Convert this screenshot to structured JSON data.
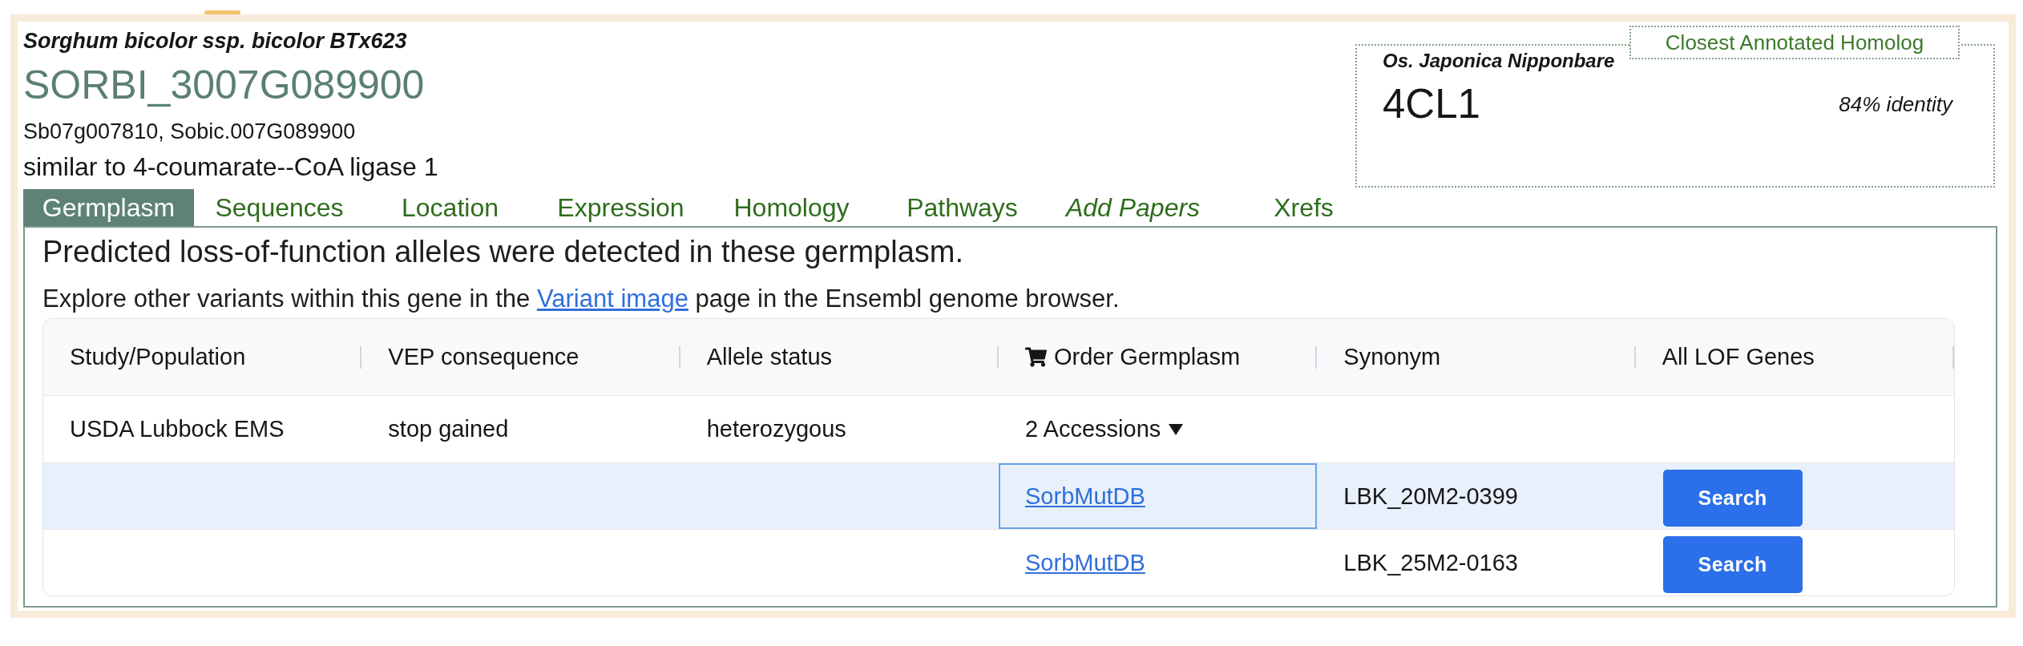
{
  "header": {
    "species": "Sorghum bicolor ssp. bicolor BTx623",
    "gene_id": "SORBI_3007G089900",
    "synonyms": "Sb07g007810, Sobic.007G089900",
    "description": "similar to 4-coumarate--CoA ligase 1"
  },
  "homolog": {
    "legend": "Closest Annotated Homolog",
    "species": "Os. Japonica Nipponbare",
    "gene": "4CL1",
    "identity": "84% identity"
  },
  "tabs": [
    {
      "label": "Germplasm",
      "kind": "section",
      "selected": true
    },
    {
      "label": "Sequences",
      "kind": "section",
      "selected": false
    },
    {
      "label": "Location",
      "kind": "section",
      "selected": false
    },
    {
      "label": "Expression",
      "kind": "section",
      "selected": false
    },
    {
      "label": "Homology",
      "kind": "section",
      "selected": false
    },
    {
      "label": "Pathways",
      "kind": "section",
      "selected": false
    },
    {
      "label": "Add Papers",
      "kind": "action",
      "selected": false
    },
    {
      "label": "Xrefs",
      "kind": "section",
      "selected": false
    }
  ],
  "panel": {
    "heading": "Predicted loss-of-function alleles were detected in these germplasm.",
    "note": {
      "before": "Explore other variants within this gene in the ",
      "link": "Variant image",
      "after": " page in the Ensembl genome browser."
    }
  },
  "table": {
    "columns": [
      {
        "label": "Study/Population",
        "kind": "text"
      },
      {
        "label": "VEP consequence",
        "kind": "text"
      },
      {
        "label": "Allele status",
        "kind": "text"
      },
      {
        "label": "Order Germplasm",
        "kind": "order"
      },
      {
        "label": "Synonym",
        "kind": "text"
      },
      {
        "label": "All LOF Genes",
        "kind": "text"
      }
    ],
    "rows": [
      {
        "cells": [
          "USDA Lubbock EMS",
          "stop gained",
          "heterozygous"
        ],
        "accessions": {
          "label": "2 Accessions",
          "expanded": true
        },
        "sub_rows": [
          {
            "source": "SorbMutDB",
            "synonym": "LBK_20M2-0399",
            "action": "Search",
            "selected": true
          },
          {
            "source": "SorbMutDB",
            "synonym": "LBK_25M2-0163",
            "action": "Search",
            "selected": false
          }
        ]
      }
    ]
  }
}
